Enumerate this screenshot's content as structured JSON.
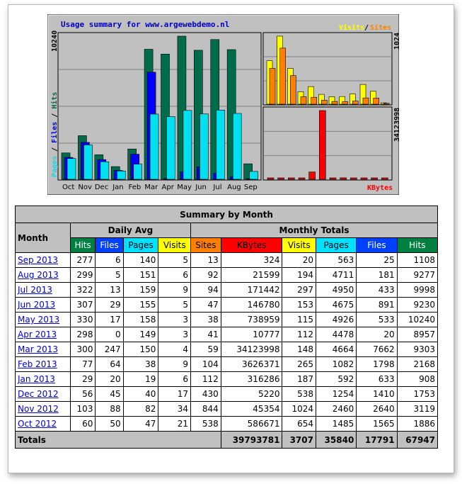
{
  "chart_data": {
    "type": "bar",
    "title": "Usage summary for www.argewebdemo.nl",
    "categories": [
      "Oct",
      "Nov",
      "Dec",
      "Jan",
      "Feb",
      "Mar",
      "Apr",
      "May",
      "Jun",
      "Jul",
      "Aug",
      "Sep"
    ],
    "panels": {
      "main": {
        "axis_max_label": "10240",
        "ylim": [
          0,
          10240
        ],
        "legend": [
          "Pages",
          "Files",
          "Hits"
        ],
        "series": [
          {
            "name": "Hits",
            "color": "#006c4a",
            "values": [
              1886,
              3119,
              1753,
              908,
              2168,
              9303,
              8957,
              10240,
              9230,
              9998,
              9277,
              1108
            ]
          },
          {
            "name": "Files",
            "color": "#0000ff",
            "values": [
              1565,
              2640,
              1410,
              633,
              1798,
              7662,
              20,
              533,
              891,
              433,
              181,
              25
            ]
          },
          {
            "name": "Pages",
            "color": "#00e0f0",
            "values": [
              1485,
              2460,
              1254,
              592,
              1082,
              4664,
              4478,
              4926,
              4675,
              4950,
              4711,
              563
            ]
          }
        ]
      },
      "visits": {
        "axis_max_label": "1024",
        "ylim": [
          0,
          1024
        ],
        "legend": [
          "Visits",
          "Sites"
        ],
        "series": [
          {
            "name": "Visits",
            "color": "#ffff00",
            "values": [
              654,
              1024,
              538,
              187,
              265,
              148,
              112,
              115,
              153,
              297,
              194,
              20
            ]
          },
          {
            "name": "Sites",
            "color": "#ff8000",
            "values": [
              538,
              844,
              430,
              112,
              104,
              59,
              41,
              38,
              47,
              94,
              92,
              13
            ]
          }
        ]
      },
      "kbytes": {
        "axis_max_label": "34123998",
        "ylim": [
          0,
          34123998
        ],
        "legend": [
          "KBytes"
        ],
        "series": [
          {
            "name": "KBytes",
            "color": "#ff0000",
            "values": [
              586671,
              45354,
              5220,
              316286,
              3626371,
              34123998,
              10777,
              738959,
              146780,
              171442,
              21599,
              324
            ]
          }
        ]
      }
    }
  },
  "table": {
    "title": "Summary by Month",
    "month_header": "Month",
    "daily_avg_header": "Daily Avg",
    "monthly_totals_header": "Monthly Totals",
    "daily_cols": [
      {
        "label": "Hits",
        "color": "#008040",
        "text": "#ffffff"
      },
      {
        "label": "Files",
        "color": "#0040ff",
        "text": "#ffffff"
      },
      {
        "label": "Pages",
        "color": "#00e0ff",
        "text": "#000000"
      },
      {
        "label": "Visits",
        "color": "#ffff00",
        "text": "#000000"
      }
    ],
    "monthly_cols": [
      {
        "label": "Sites",
        "color": "#ff8000",
        "text": "#000000"
      },
      {
        "label": "KBytes",
        "color": "#ff0000",
        "text": "#000000"
      },
      {
        "label": "Visits",
        "color": "#ffff00",
        "text": "#000000"
      },
      {
        "label": "Pages",
        "color": "#00e0ff",
        "text": "#000000"
      },
      {
        "label": "Files",
        "color": "#0040ff",
        "text": "#ffffff"
      },
      {
        "label": "Hits",
        "color": "#008040",
        "text": "#ffffff"
      }
    ],
    "rows": [
      {
        "month": "Sep 2013",
        "cells": [
          "277",
          "6",
          "140",
          "5",
          "13",
          "324",
          "20",
          "563",
          "25",
          "1108"
        ]
      },
      {
        "month": "Aug 2013",
        "cells": [
          "299",
          "5",
          "151",
          "6",
          "92",
          "21599",
          "194",
          "4711",
          "181",
          "9277"
        ]
      },
      {
        "month": "Jul 2013",
        "cells": [
          "322",
          "13",
          "159",
          "9",
          "94",
          "171442",
          "297",
          "4950",
          "433",
          "9998"
        ]
      },
      {
        "month": "Jun 2013",
        "cells": [
          "307",
          "29",
          "155",
          "5",
          "47",
          "146780",
          "153",
          "4675",
          "891",
          "9230"
        ]
      },
      {
        "month": "May 2013",
        "cells": [
          "330",
          "17",
          "158",
          "3",
          "38",
          "738959",
          "115",
          "4926",
          "533",
          "10240"
        ]
      },
      {
        "month": "Apr 2013",
        "cells": [
          "298",
          "0",
          "149",
          "3",
          "41",
          "10777",
          "112",
          "4478",
          "20",
          "8957"
        ]
      },
      {
        "month": "Mar 2013",
        "cells": [
          "300",
          "247",
          "150",
          "4",
          "59",
          "34123998",
          "148",
          "4664",
          "7662",
          "9303"
        ]
      },
      {
        "month": "Feb 2013",
        "cells": [
          "77",
          "64",
          "38",
          "9",
          "104",
          "3626371",
          "265",
          "1082",
          "1798",
          "2168"
        ]
      },
      {
        "month": "Jan 2013",
        "cells": [
          "29",
          "20",
          "19",
          "6",
          "112",
          "316286",
          "187",
          "592",
          "633",
          "908"
        ]
      },
      {
        "month": "Dec 2012",
        "cells": [
          "56",
          "45",
          "40",
          "17",
          "430",
          "5220",
          "538",
          "1254",
          "1410",
          "1753"
        ]
      },
      {
        "month": "Nov 2012",
        "cells": [
          "103",
          "88",
          "82",
          "34",
          "844",
          "45354",
          "1024",
          "2460",
          "2640",
          "3119"
        ]
      },
      {
        "month": "Oct 2012",
        "cells": [
          "60",
          "50",
          "47",
          "21",
          "538",
          "586671",
          "654",
          "1485",
          "1565",
          "1886"
        ]
      }
    ],
    "totals": {
      "label": "Totals",
      "cells": [
        "39793781",
        "3707",
        "35840",
        "17791",
        "67947"
      ]
    }
  }
}
